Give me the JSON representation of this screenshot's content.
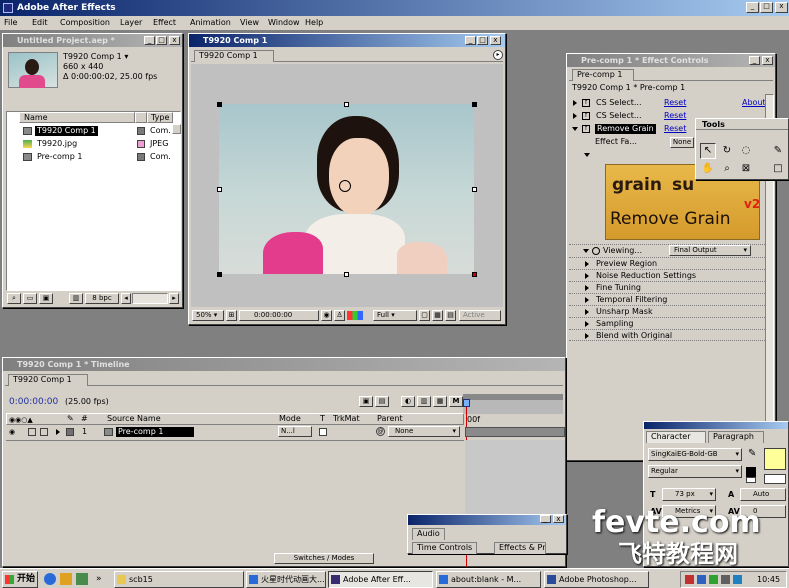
{
  "app": {
    "title": "Adobe After Effects"
  },
  "menu": [
    "File",
    "Edit",
    "Composition",
    "Layer",
    "Effect",
    "Animation",
    "View",
    "Window",
    "Help"
  ],
  "project": {
    "title": "Untitled Project.aep *",
    "thumb_name": "T9920 Comp 1 ▾",
    "thumb_size": "660 x 440",
    "thumb_duration": "Δ 0:00:00:02, 25.00 fps",
    "col_name": "Name",
    "col_type": "Type",
    "items": [
      {
        "name": "T9920 Comp 1",
        "type": "Com."
      },
      {
        "name": "T9920.jpg",
        "type": "JPEG"
      },
      {
        "name": "Pre-comp 1",
        "type": "Com."
      }
    ],
    "bpc": "8 bpc"
  },
  "comp": {
    "title": "T9920 Comp 1",
    "tab": "T9920 Comp 1",
    "zoom": "50%",
    "timecode": "0:00:00:00",
    "resolution": "Full",
    "camera": "Active"
  },
  "effects": {
    "title": "Pre-comp 1 * Effect Controls",
    "tab": "Pre-comp 1",
    "breadcrumb": "T9920 Comp 1 * Pre-comp 1",
    "rows": [
      {
        "name": "CS Select...",
        "reset": "Reset",
        "extra": "About"
      },
      {
        "name": "CS Select...",
        "reset": "Reset",
        "extra": ""
      },
      {
        "name": "Remove Grain",
        "reset": "Reset",
        "extra": ""
      }
    ],
    "effect_fa": "Effect Fa...",
    "none_btn": "None",
    "logo_top": "grain",
    "logo_top2": "su",
    "logo_main": "Remove Grain",
    "logo_badge": "v2",
    "viewing_label": "Viewing...",
    "viewing_value": "Final Output",
    "groups": [
      "Preview Region",
      "Noise Reduction Settings",
      "Fine Tuning",
      "Temporal Filtering",
      "Unsharp Mask",
      "Sampling",
      "Blend with Original"
    ]
  },
  "tools": {
    "title": "Tools"
  },
  "timeline": {
    "title": "T9920 Comp 1 * Timeline",
    "tab": "T9920 Comp 1",
    "timecode": "0:00:00:00",
    "fps": "(25.00 fps)",
    "ruler_start": "00f",
    "col_num": "#",
    "col_source": "Source Name",
    "col_mode": "Mode",
    "col_t": "T",
    "col_trkmat": "TrkMat",
    "col_parent": "Parent",
    "layer": {
      "num": "1",
      "name": "Pre-comp 1",
      "mode": "N...l",
      "parent": "None"
    },
    "switches": "Switches / Modes"
  },
  "character": {
    "tab1": "Character",
    "tab2": "Paragraph",
    "font": "SingKaiEG-Bold-GB",
    "style": "Regular",
    "size": "73 px",
    "leading": "Auto",
    "kerning": "Metrics",
    "tracking": "0",
    "fill_color": "#ffff99"
  },
  "audio": {
    "tab1": "Audio",
    "tab2": "Time Controls",
    "tab3": "Effects & Pr"
  },
  "watermark": {
    "top": "fevte.com",
    "bottom": "飞特教程网"
  },
  "taskbar": {
    "start": "开始",
    "items": [
      "scb15",
      "火星时代动画大...",
      "Adobe After Eff...",
      "about:blank - M...",
      "Adobe Photoshop..."
    ],
    "clock": "10:45"
  }
}
